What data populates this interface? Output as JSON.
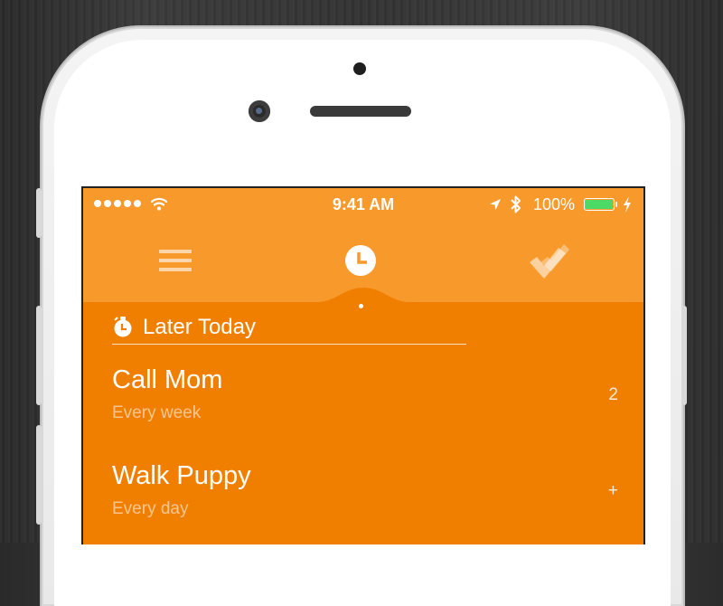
{
  "status_bar": {
    "time": "9:41 AM",
    "battery_percent": "100%",
    "battery_level": 1.0,
    "signal_dots": 5
  },
  "nav": {
    "active_tab": "later",
    "icons": [
      "menu-icon",
      "clock-icon",
      "done-checkmarks-icon"
    ]
  },
  "section": {
    "title": "Later Today",
    "icon": "alarm-clock-icon"
  },
  "tasks": [
    {
      "title": "Call Mom",
      "recurrence": "Every week",
      "meta": "2"
    },
    {
      "title": "Walk Puppy",
      "recurrence": "Every day",
      "meta": "+"
    }
  ],
  "colors": {
    "header": "#f79a2b",
    "body": "#f07f00",
    "battery_fill": "#4cd964"
  }
}
